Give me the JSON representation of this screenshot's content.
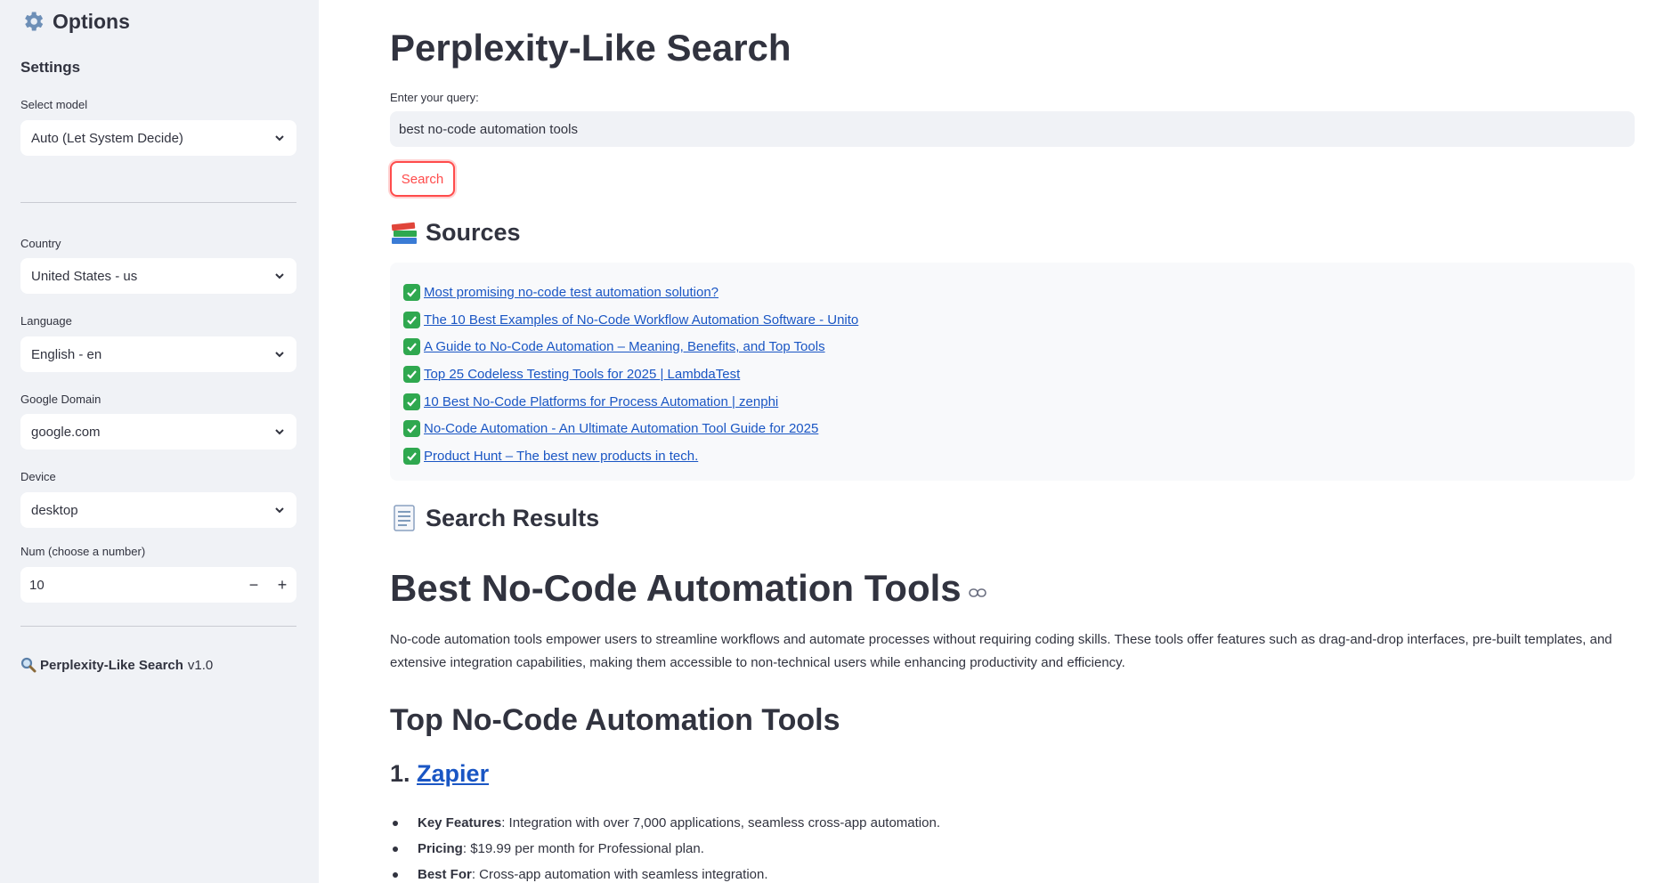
{
  "sidebar": {
    "title": "Options",
    "settings_heading": "Settings",
    "model": {
      "label": "Select model",
      "value": "Auto (Let System Decide)"
    },
    "country": {
      "label": "Country",
      "value": "United States - us"
    },
    "language": {
      "label": "Language",
      "value": "English - en"
    },
    "google_domain": {
      "label": "Google Domain",
      "value": "google.com"
    },
    "device": {
      "label": "Device",
      "value": "desktop"
    },
    "num": {
      "label": "Num (choose a number)",
      "value": "10",
      "minus": "−",
      "plus": "+"
    },
    "footer": {
      "name": "Perplexity-Like Search",
      "version": "v1.0"
    }
  },
  "main": {
    "title": "Perplexity-Like Search",
    "query_label": "Enter your query:",
    "query_value": "best no-code automation tools",
    "search_button": "Search",
    "sources_heading": "Sources",
    "sources": [
      "Most promising no-code test automation solution?",
      "The 10 Best Examples of No-Code Workflow Automation Software - Unito",
      "A Guide to No-Code Automation – Meaning, Benefits, and Top Tools",
      "Top 25 Codeless Testing Tools for 2025 | LambdaTest",
      "10 Best No-Code Platforms for Process Automation | zenphi",
      "No-Code Automation - An Ultimate Automation Tool Guide for 2025",
      "Product Hunt – The best new products in tech."
    ],
    "results_heading": "Search Results",
    "result_title": "Best No-Code Automation Tools",
    "result_paragraph": "No-code automation tools empower users to streamline workflows and automate processes without requiring coding skills. These tools offer features such as drag-and-drop interfaces, pre-built templates, and extensive integration capabilities, making them accessible to non-technical users while enhancing productivity and efficiency.",
    "section_heading": "Top No-Code Automation Tools",
    "tool1": {
      "number": "1.",
      "name": "Zapier",
      "bullets": [
        {
          "key": "Key Features",
          "text": ": Integration with over 7,000 applications, seamless cross-app automation."
        },
        {
          "key": "Pricing",
          "text": ": $19.99 per month for Professional plan."
        },
        {
          "key": "Best For",
          "text": ": Cross-app automation with seamless integration."
        }
      ]
    }
  },
  "colors": {
    "sidebar_bg": "#f0f2f6",
    "accent": "#ff4b4b",
    "link": "#1a56c4",
    "text": "#31333f"
  }
}
